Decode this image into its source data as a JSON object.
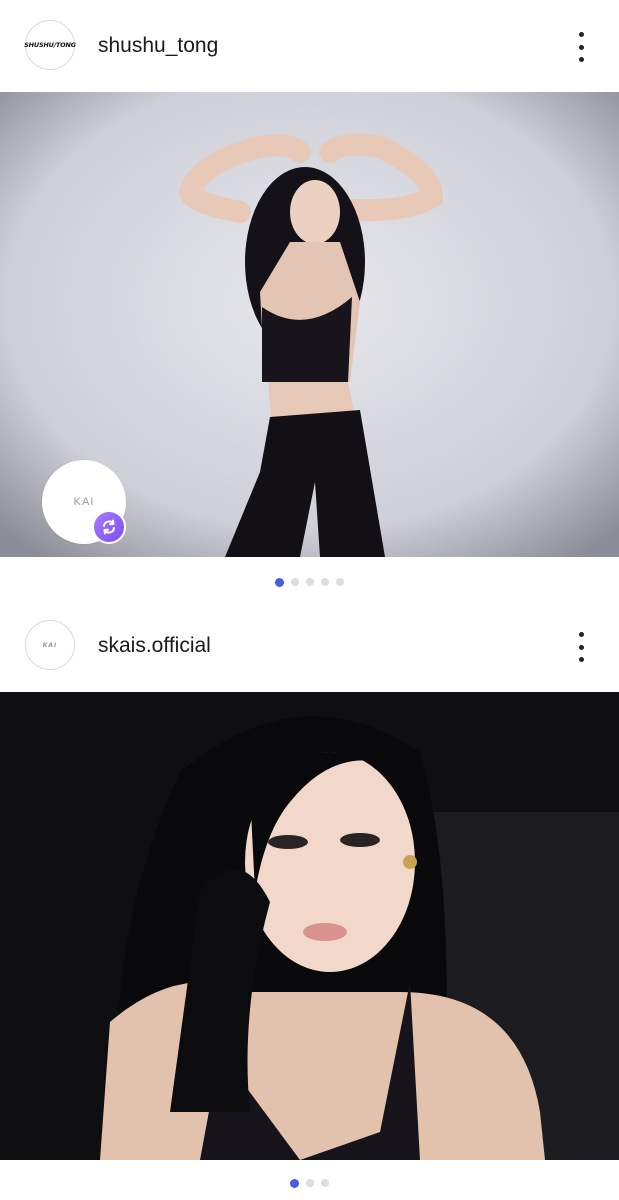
{
  "posts": [
    {
      "avatar_text": "SHUSHU/TONG",
      "username": "shushu_tong",
      "more_icon": "more-vertical-icon",
      "photo_desc_icon": "photo",
      "badge_text": "KAI",
      "badge_icon": "repost-icon",
      "pager_count": 5,
      "pager_active": 1
    },
    {
      "avatar_text": "KAI",
      "username": "skais.official",
      "more_icon": "more-vertical-icon",
      "pager_count": 3,
      "pager_active": 1
    }
  ],
  "colors": {
    "pager_active": "#4a5be8",
    "pager_inactive": "#dcdde3",
    "repost_badge": "#8a5cf6"
  }
}
